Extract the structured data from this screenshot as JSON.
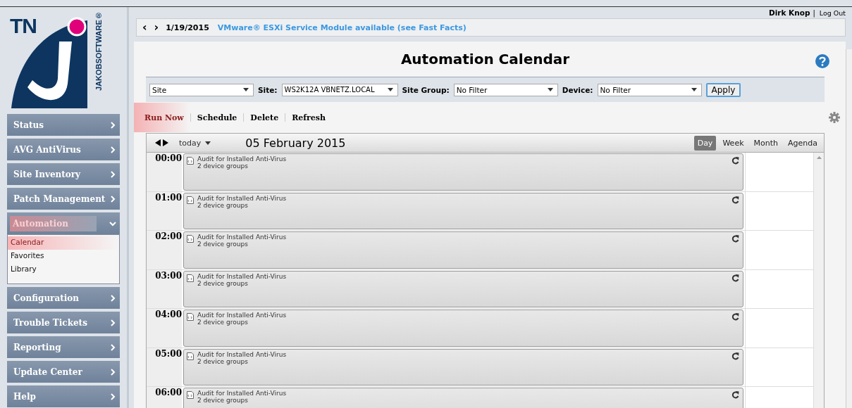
{
  "user": {
    "name": "Dirk Knop",
    "separator": "|",
    "logout": "Log Out"
  },
  "logo": {
    "letters": "TN",
    "vertical": "JAKOBSOFTWARE®"
  },
  "nav": [
    {
      "label": "Status",
      "expanded": false
    },
    {
      "label": "AVG AntiVirus",
      "expanded": false
    },
    {
      "label": "Site Inventory",
      "expanded": false
    },
    {
      "label": "Patch Management",
      "expanded": false
    },
    {
      "label": "Automation",
      "expanded": true,
      "children": [
        {
          "label": "Calendar",
          "selected": true
        },
        {
          "label": "Favorites",
          "selected": false
        },
        {
          "label": "Library",
          "selected": false
        }
      ]
    },
    {
      "label": "Configuration",
      "expanded": false
    },
    {
      "label": "Trouble Tickets",
      "expanded": false
    },
    {
      "label": "Reporting",
      "expanded": false
    },
    {
      "label": "Update Center",
      "expanded": false
    },
    {
      "label": "Help",
      "expanded": false
    }
  ],
  "news": {
    "prev": "‹",
    "next": "›",
    "date": "1/19/2015",
    "message": "VMware® ESXi Service Module available (see Fast Facts)"
  },
  "title": "Automation Calendar",
  "filters": [
    {
      "value": "Site"
    },
    {
      "label": "Site:",
      "value": "WS2K12A VBNETZ.LOCAL"
    },
    {
      "label": "Site Group:",
      "value": "No Filter"
    },
    {
      "label": "Device:",
      "value": "No Filter"
    }
  ],
  "apply": "Apply",
  "actions": [
    {
      "label": "Run Now",
      "selected": true
    },
    {
      "label": "Schedule",
      "selected": false
    },
    {
      "label": "Delete",
      "selected": false
    },
    {
      "label": "Refresh",
      "selected": false
    }
  ],
  "calendar": {
    "today": "today",
    "date": "05 February 2015",
    "views": [
      {
        "label": "Day",
        "selected": true
      },
      {
        "label": "Week",
        "selected": false
      },
      {
        "label": "Month",
        "selected": false
      },
      {
        "label": "Agenda",
        "selected": false
      }
    ],
    "rows": [
      {
        "time": "00:00",
        "title": "Audit for Installed Anti-Virus",
        "subtitle": "2 device groups"
      },
      {
        "time": "01:00",
        "title": "Audit for Installed Anti-Virus",
        "subtitle": "2 device groups"
      },
      {
        "time": "02:00",
        "title": "Audit for Installed Anti-Virus",
        "subtitle": "2 device groups"
      },
      {
        "time": "03:00",
        "title": "Audit for Installed Anti-Virus",
        "subtitle": "2 device groups"
      },
      {
        "time": "04:00",
        "title": "Audit for Installed Anti-Virus",
        "subtitle": "2 device groups"
      },
      {
        "time": "05:00",
        "title": "Audit for Installed Anti-Virus",
        "subtitle": "2 device groups"
      },
      {
        "time": "06:00",
        "title": "Audit for Installed Anti-Virus",
        "subtitle": "2 device groups"
      }
    ]
  }
}
